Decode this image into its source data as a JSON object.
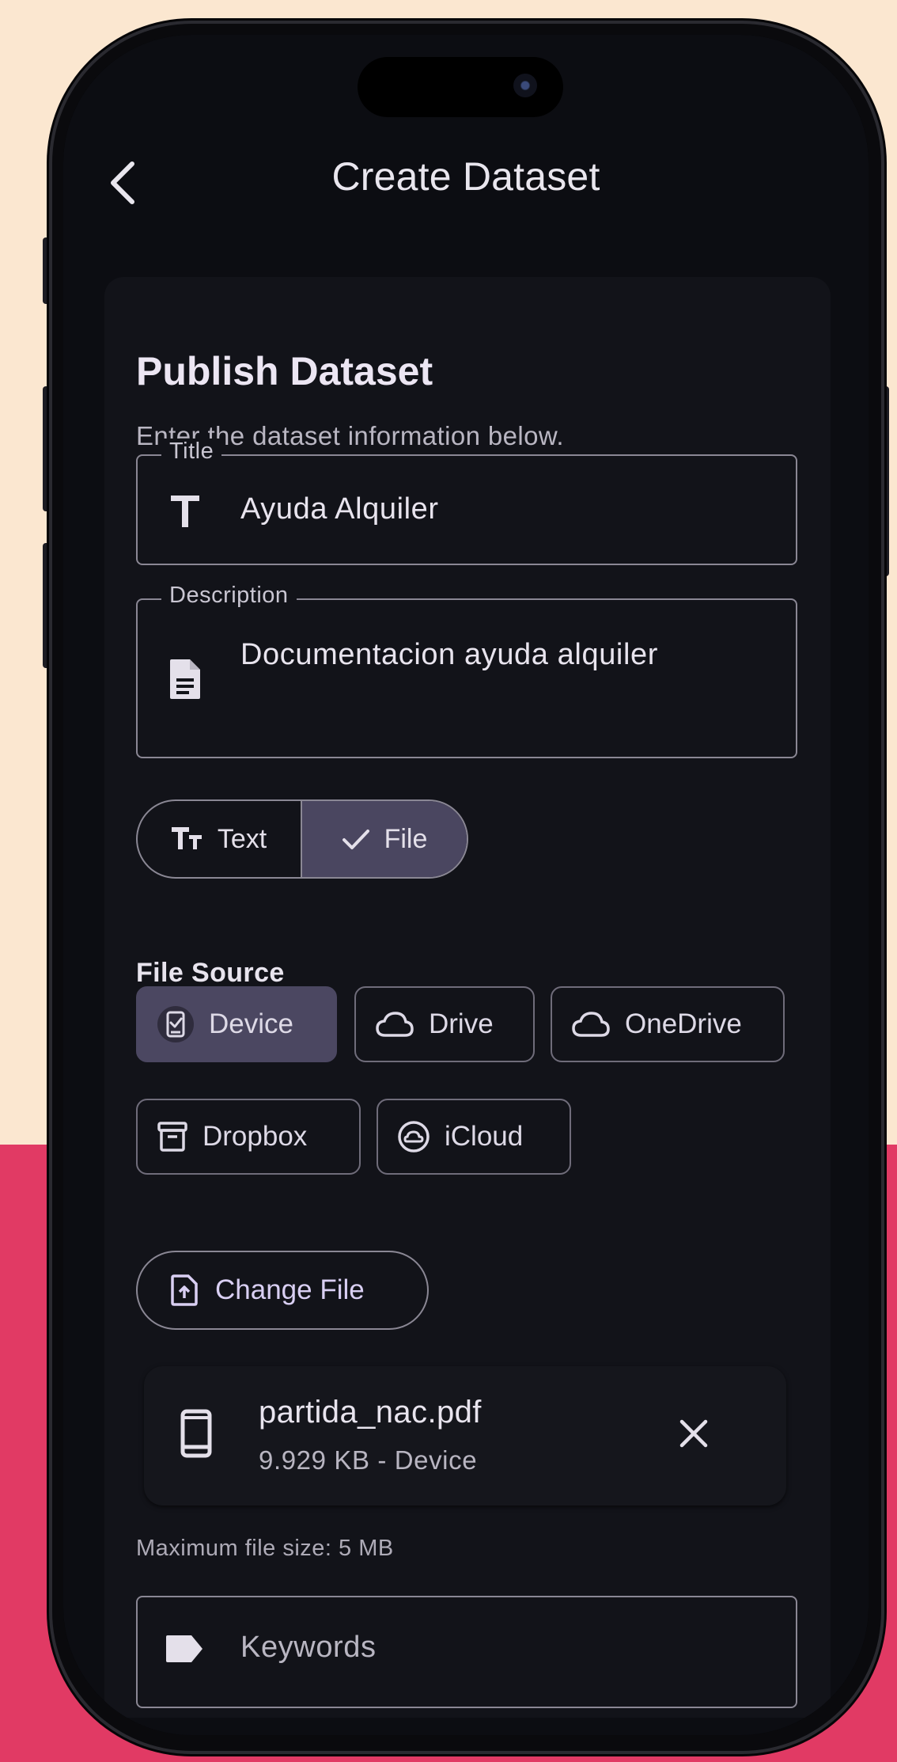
{
  "header": {
    "title": "Create Dataset"
  },
  "form": {
    "heading": "Publish Dataset",
    "subheading": "Enter the dataset information below.",
    "title_field": {
      "label": "Title",
      "value": "Ayuda Alquiler"
    },
    "description_field": {
      "label": "Description",
      "value": "Documentacion ayuda alquiler"
    },
    "type_toggle": {
      "text_label": "Text",
      "file_label": "File",
      "selected": "File"
    },
    "file_source": {
      "label": "File Source",
      "options": [
        "Device",
        "Drive",
        "OneDrive",
        "Dropbox",
        "iCloud"
      ],
      "selected": "Device"
    },
    "change_file_label": "Change File",
    "selected_file": {
      "name": "partida_nac.pdf",
      "meta": "9.929 KB - Device"
    },
    "max_size_note": "Maximum file size: 5 MB",
    "keywords_placeholder": "Keywords"
  },
  "colors": {
    "page_top": "#fbe7d0",
    "page_bottom": "#e13a64",
    "screen_bg": "#0c0d12",
    "card_bg": "#121319",
    "selected_bg": "#4b4761",
    "accent_text": "#d9cff3"
  }
}
